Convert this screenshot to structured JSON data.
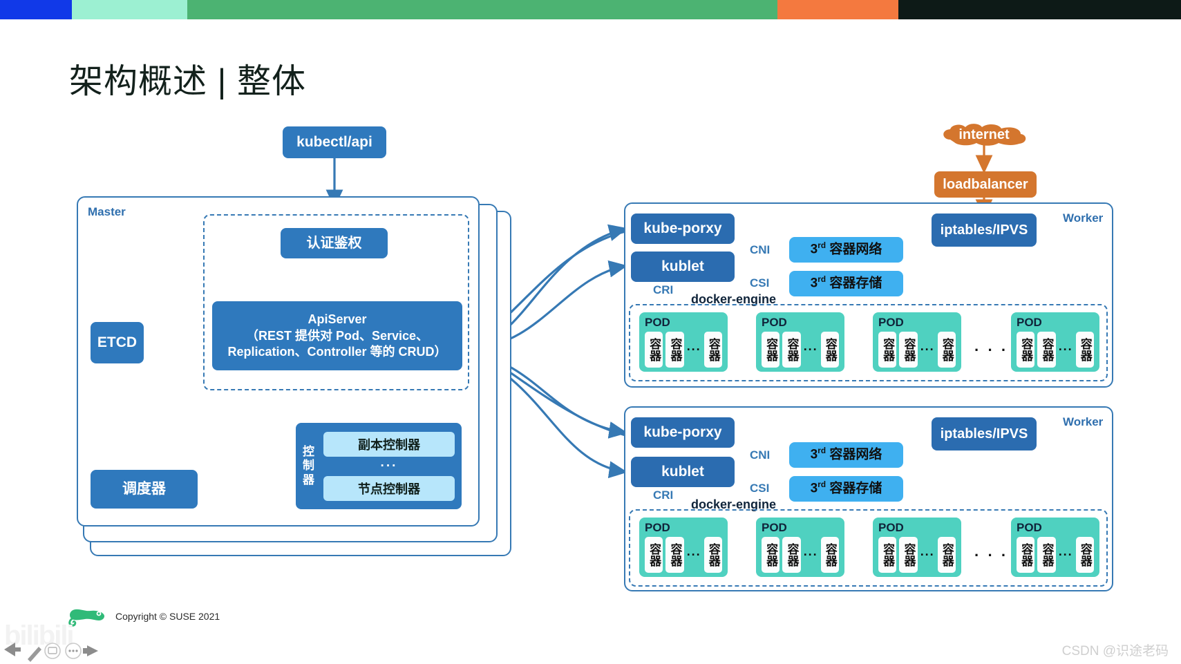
{
  "topbar": {
    "colors": [
      "#1139e8",
      "#9cf0d2",
      "#4cb372",
      "#f4793f",
      "#0d1a17"
    ],
    "widths": [
      104,
      167,
      854,
      175,
      409
    ]
  },
  "title": "架构概述 | 整体",
  "entrypoint": {
    "label": "kubectl/api"
  },
  "master": {
    "label": "Master",
    "auth": {
      "label": "认证鉴权"
    },
    "apiserver": {
      "line1": "ApiServer",
      "line2": "（REST 提供对 Pod、Service、",
      "line3": "Replication、Controller 等的 CRUD）"
    },
    "etcd": {
      "label": "ETCD"
    },
    "scheduler": {
      "label": "调度器"
    },
    "controller": {
      "side_label": "控制器",
      "items": [
        "副本控制器",
        "节点控制器"
      ],
      "dots": "···"
    }
  },
  "external": {
    "internet": {
      "label": "internet"
    },
    "loadbalancer": {
      "label": "loadbalancer"
    }
  },
  "workers": [
    {
      "label": "Worker",
      "kube_proxy": "kube-porxy",
      "kubelet": "kublet",
      "iptables": "iptables/IPVS",
      "cni_label": "CNI",
      "csi_label": "CSI",
      "cri_label": "CRI",
      "docker_engine": "docker-engine",
      "network_plugin": {
        "sup": "3",
        "sup_ord": "rd",
        "text": "容器网络"
      },
      "storage_plugin": {
        "sup": "3",
        "sup_ord": "rd",
        "text": "容器存储"
      },
      "pods": [
        {
          "label": "POD",
          "containers": [
            "容器",
            "容器",
            "容器"
          ],
          "inner_dots": "···"
        },
        {
          "label": "POD",
          "containers": [
            "容器",
            "容器",
            "容器"
          ],
          "inner_dots": "···"
        },
        {
          "label": "POD",
          "containers": [
            "容器",
            "容器",
            "容器"
          ],
          "inner_dots": "···"
        },
        {
          "label": "POD",
          "containers": [
            "容器",
            "容器",
            "容器"
          ],
          "inner_dots": "···"
        }
      ],
      "pod_gap_dots": "· · ·"
    },
    {
      "label": "Worker",
      "kube_proxy": "kube-porxy",
      "kubelet": "kublet",
      "iptables": "iptables/IPVS",
      "cni_label": "CNI",
      "csi_label": "CSI",
      "cri_label": "CRI",
      "docker_engine": "docker-engine",
      "network_plugin": {
        "sup": "3",
        "sup_ord": "rd",
        "text": "容器网络"
      },
      "storage_plugin": {
        "sup": "3",
        "sup_ord": "rd",
        "text": "容器存储"
      },
      "pods": [
        {
          "label": "POD",
          "containers": [
            "容器",
            "容器",
            "容器"
          ],
          "inner_dots": "···"
        },
        {
          "label": "POD",
          "containers": [
            "容器",
            "容器",
            "容器"
          ],
          "inner_dots": "···"
        },
        {
          "label": "POD",
          "containers": [
            "容器",
            "容器",
            "容器"
          ],
          "inner_dots": "···"
        },
        {
          "label": "POD",
          "containers": [
            "容器",
            "容器",
            "容器"
          ],
          "inner_dots": "···"
        }
      ],
      "pod_gap_dots": "· · ·"
    }
  ],
  "footer": {
    "copyright": "Copyright © SUSE 2021",
    "csdn": "CSDN @识途老码",
    "bilibili": "bilibili"
  },
  "colors": {
    "node_blue": "#2f79bd",
    "node_dark_blue": "#2b6cb0",
    "node_light_blue": "#3fb0f0",
    "node_pale_blue": "#b7e6fb",
    "orange": "#d4762e",
    "pod_teal": "#4fd1c0",
    "frame_border": "#3679b4",
    "arrow": "#3679b4"
  }
}
